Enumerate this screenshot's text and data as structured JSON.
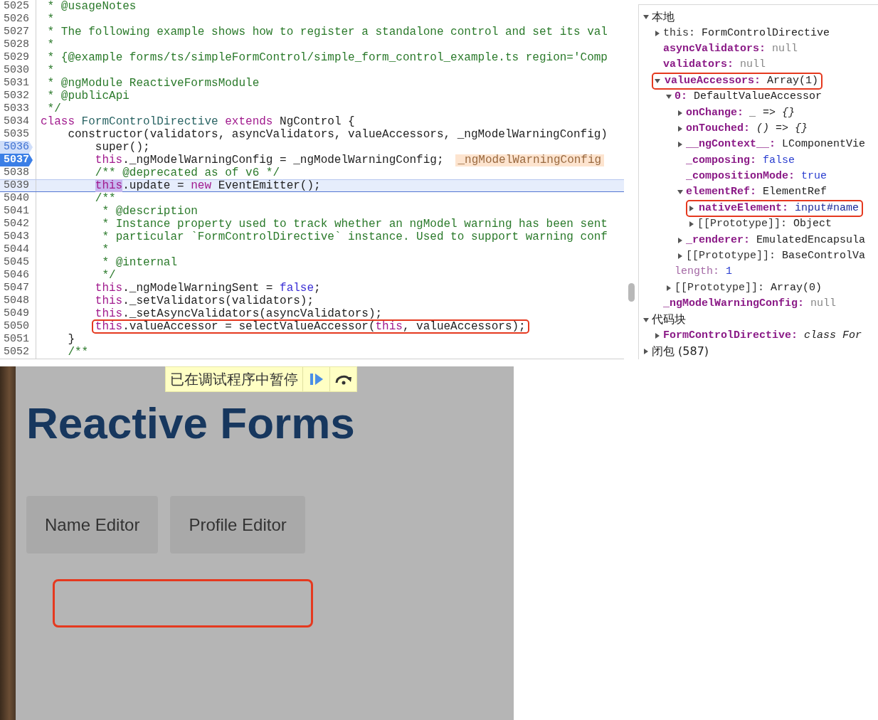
{
  "source": {
    "lines": [
      {
        "number": "5025",
        "tokens": [
          {
            "text": " * @usageNotes",
            "kind": "comment"
          }
        ],
        "breakpoint": false,
        "current": false,
        "boxed": false
      },
      {
        "number": "5026",
        "tokens": [
          {
            "text": " *",
            "kind": "comment"
          }
        ],
        "breakpoint": false,
        "current": false,
        "boxed": false
      },
      {
        "number": "5027",
        "tokens": [
          {
            "text": " * The following example shows how to register a standalone control and set its val",
            "kind": "comment"
          }
        ],
        "breakpoint": false,
        "current": false,
        "boxed": false
      },
      {
        "number": "5028",
        "tokens": [
          {
            "text": " *",
            "kind": "comment"
          }
        ],
        "breakpoint": false,
        "current": false,
        "boxed": false
      },
      {
        "number": "5029",
        "tokens": [
          {
            "text": " * {@example forms/ts/simpleFormControl/simple_form_control_example.ts region='Comp",
            "kind": "comment"
          }
        ],
        "breakpoint": false,
        "current": false,
        "boxed": false
      },
      {
        "number": "5030",
        "tokens": [
          {
            "text": " *",
            "kind": "comment"
          }
        ],
        "breakpoint": false,
        "current": false,
        "boxed": false
      },
      {
        "number": "5031",
        "tokens": [
          {
            "text": " * @ngModule ReactiveFormsModule",
            "kind": "comment"
          }
        ],
        "breakpoint": false,
        "current": false,
        "boxed": false
      },
      {
        "number": "5032",
        "tokens": [
          {
            "text": " * @publicApi",
            "kind": "comment"
          }
        ],
        "breakpoint": false,
        "current": false,
        "boxed": false
      },
      {
        "number": "5033",
        "tokens": [
          {
            "text": " */",
            "kind": "comment"
          }
        ],
        "breakpoint": false,
        "current": false,
        "boxed": false
      },
      {
        "number": "5034",
        "tokens": [
          {
            "text": "class",
            "kind": "keyword"
          },
          {
            "text": " FormControlDirective ",
            "kind": "type"
          },
          {
            "text": "extends",
            "kind": "keyword"
          },
          {
            "text": " NgControl {",
            "kind": "plain"
          }
        ],
        "breakpoint": false,
        "current": false,
        "boxed": false
      },
      {
        "number": "5035",
        "tokens": [
          {
            "text": "    constructor(validators, asyncValidators, valueAccessors, _ngModelWarningConfig)",
            "kind": "plain"
          }
        ],
        "breakpoint": false,
        "current": false,
        "boxed": false
      },
      {
        "number": "5036",
        "tokens": [
          {
            "text": "        super();",
            "kind": "plain"
          }
        ],
        "breakpoint": true,
        "breakpoint_enabled": false,
        "current": false,
        "boxed": false
      },
      {
        "number": "5037",
        "tokens": [
          {
            "text": "        this",
            "kind": "keyword"
          },
          {
            "text": "._ngModelWarningConfig = _ngModelWarningConfig;",
            "kind": "plain"
          }
        ],
        "inline_value": "_ngModelWarningConfig",
        "breakpoint": true,
        "breakpoint_enabled": true,
        "current": false,
        "boxed": false
      },
      {
        "number": "5038",
        "tokens": [
          {
            "text": "        /** @deprecated as of v6 */",
            "kind": "comment"
          }
        ],
        "breakpoint": false,
        "current": false,
        "boxed": false
      },
      {
        "number": "5039",
        "tokens": [
          {
            "text": "        this",
            "kind": "keyword-highlight"
          },
          {
            "text": ".update = ",
            "kind": "plain"
          },
          {
            "text": "new",
            "kind": "keyword"
          },
          {
            "text": " EventEmitter();",
            "kind": "plain"
          }
        ],
        "breakpoint": false,
        "current": true,
        "boxed": false
      },
      {
        "number": "5040",
        "tokens": [
          {
            "text": "        /**",
            "kind": "comment"
          }
        ],
        "breakpoint": false,
        "current": false,
        "boxed": false
      },
      {
        "number": "5041",
        "tokens": [
          {
            "text": "         * @description",
            "kind": "comment"
          }
        ],
        "breakpoint": false,
        "current": false,
        "boxed": false
      },
      {
        "number": "5042",
        "tokens": [
          {
            "text": "         * Instance property used to track whether an ngModel warning has been sent",
            "kind": "comment"
          }
        ],
        "breakpoint": false,
        "current": false,
        "boxed": false
      },
      {
        "number": "5043",
        "tokens": [
          {
            "text": "         * particular `FormControlDirective` instance. Used to support warning conf",
            "kind": "comment"
          }
        ],
        "breakpoint": false,
        "current": false,
        "boxed": false
      },
      {
        "number": "5044",
        "tokens": [
          {
            "text": "         *",
            "kind": "comment"
          }
        ],
        "breakpoint": false,
        "current": false,
        "boxed": false
      },
      {
        "number": "5045",
        "tokens": [
          {
            "text": "         * @internal",
            "kind": "comment"
          }
        ],
        "breakpoint": false,
        "current": false,
        "boxed": false
      },
      {
        "number": "5046",
        "tokens": [
          {
            "text": "         */",
            "kind": "comment"
          }
        ],
        "breakpoint": false,
        "current": false,
        "boxed": false
      },
      {
        "number": "5047",
        "tokens": [
          {
            "text": "        this",
            "kind": "keyword"
          },
          {
            "text": "._ngModelWarningSent = ",
            "kind": "plain"
          },
          {
            "text": "false",
            "kind": "literal"
          },
          {
            "text": ";",
            "kind": "plain"
          }
        ],
        "breakpoint": false,
        "current": false,
        "boxed": false
      },
      {
        "number": "5048",
        "tokens": [
          {
            "text": "        this",
            "kind": "keyword"
          },
          {
            "text": "._setValidators(validators);",
            "kind": "plain"
          }
        ],
        "breakpoint": false,
        "current": false,
        "boxed": false
      },
      {
        "number": "5049",
        "tokens": [
          {
            "text": "        this",
            "kind": "keyword"
          },
          {
            "text": "._setAsyncValidators(asyncValidators);",
            "kind": "plain"
          }
        ],
        "breakpoint": false,
        "current": false,
        "boxed": false
      },
      {
        "number": "5050",
        "tokens": [
          {
            "text": "        this",
            "kind": "keyword"
          },
          {
            "text": ".valueAccessor = selectValueAccessor(",
            "kind": "plain"
          },
          {
            "text": "this",
            "kind": "keyword"
          },
          {
            "text": ", valueAccessors);",
            "kind": "plain"
          }
        ],
        "breakpoint": false,
        "current": false,
        "boxed": true
      },
      {
        "number": "5051",
        "tokens": [
          {
            "text": "    }",
            "kind": "plain"
          }
        ],
        "breakpoint": false,
        "current": false,
        "boxed": false
      },
      {
        "number": "5052",
        "tokens": [
          {
            "text": "    /**",
            "kind": "comment"
          }
        ],
        "breakpoint": false,
        "current": false,
        "boxed": false
      }
    ]
  },
  "scope": {
    "sections": [
      {
        "label": "本地",
        "expanded": true,
        "children": [
          {
            "name": "this:",
            "value": [
              {
                "text": "FormControlDirective",
                "kind": "plain"
              }
            ],
            "kind": "plain",
            "expanded": false,
            "boxed": false
          },
          {
            "name": "asyncValidators:",
            "value": [
              {
                "text": "null",
                "kind": "null"
              }
            ],
            "kind": "property",
            "boxed": false
          },
          {
            "name": "validators:",
            "value": [
              {
                "text": "null",
                "kind": "null"
              }
            ],
            "kind": "property",
            "boxed": false
          },
          {
            "name": "valueAccessors:",
            "value": [
              {
                "text": "Array(1)",
                "kind": "plain"
              }
            ],
            "kind": "property",
            "expanded": true,
            "boxed": true,
            "children": [
              {
                "name": "0:",
                "value": [
                  {
                    "text": "DefaultValueAccessor",
                    "kind": "plain"
                  }
                ],
                "kind": "property",
                "expanded": true,
                "boxed": false,
                "children": [
                  {
                    "name": "onChange:",
                    "value": [
                      {
                        "text": "_ => {}",
                        "kind": "function"
                      }
                    ],
                    "kind": "property",
                    "expanded": false,
                    "boxed": false
                  },
                  {
                    "name": "onTouched:",
                    "value": [
                      {
                        "text": "() => {}",
                        "kind": "function"
                      }
                    ],
                    "kind": "property",
                    "expanded": false,
                    "boxed": false
                  },
                  {
                    "name": "__ngContext__:",
                    "value": [
                      {
                        "text": "LComponentVie",
                        "kind": "plain"
                      }
                    ],
                    "kind": "property",
                    "expanded": false,
                    "boxed": false
                  },
                  {
                    "name": "_composing:",
                    "value": [
                      {
                        "text": "false",
                        "kind": "keyword"
                      }
                    ],
                    "kind": "property",
                    "boxed": false
                  },
                  {
                    "name": "_compositionMode:",
                    "value": [
                      {
                        "text": "true",
                        "kind": "keyword"
                      }
                    ],
                    "kind": "property",
                    "boxed": false
                  },
                  {
                    "name": "elementRef:",
                    "value": [
                      {
                        "text": "ElementRef",
                        "kind": "plain"
                      }
                    ],
                    "kind": "property",
                    "expanded": true,
                    "boxed": false,
                    "children": [
                      {
                        "name": "nativeElement:",
                        "value": [
                          {
                            "text": "input#name",
                            "kind": "node"
                          }
                        ],
                        "kind": "property",
                        "expanded": false,
                        "boxed": true
                      },
                      {
                        "name": "[[Prototype]]:",
                        "value": [
                          {
                            "text": "Object",
                            "kind": "plain"
                          }
                        ],
                        "kind": "plain",
                        "expanded": false,
                        "boxed": false
                      }
                    ]
                  },
                  {
                    "name": "_renderer:",
                    "value": [
                      {
                        "text": "EmulatedEncapsula",
                        "kind": "plain"
                      }
                    ],
                    "kind": "property",
                    "expanded": false,
                    "boxed": false
                  },
                  {
                    "name": "[[Prototype]]:",
                    "value": [
                      {
                        "text": "BaseControlVa",
                        "kind": "plain"
                      }
                    ],
                    "kind": "plain",
                    "expanded": false,
                    "boxed": false
                  }
                ]
              },
              {
                "name": "length:",
                "value": [
                  {
                    "text": "1",
                    "kind": "keyword"
                  }
                ],
                "kind": "inherited",
                "boxed": false
              },
              {
                "name": "[[Prototype]]:",
                "value": [
                  {
                    "text": "Array(0)",
                    "kind": "plain"
                  }
                ],
                "kind": "plain",
                "expanded": false,
                "boxed": false
              }
            ]
          },
          {
            "name": "_ngModelWarningConfig:",
            "value": [
              {
                "text": "null",
                "kind": "null"
              }
            ],
            "kind": "property",
            "boxed": false
          }
        ]
      },
      {
        "label": "代码块",
        "expanded": true,
        "children": [
          {
            "name": "FormControlDirective:",
            "value": [
              {
                "text": "class For",
                "kind": "function"
              }
            ],
            "kind": "property",
            "expanded": false,
            "boxed": false
          }
        ]
      },
      {
        "label": "闭包 (587)",
        "expanded": false
      }
    ]
  },
  "preview": {
    "banner": {
      "text": "已在调试程序中暂停"
    },
    "heading": "Reactive Forms",
    "buttons": [
      {
        "label": "Name Editor"
      },
      {
        "label": "Profile Editor"
      }
    ],
    "input": {
      "highlighted": true
    }
  }
}
